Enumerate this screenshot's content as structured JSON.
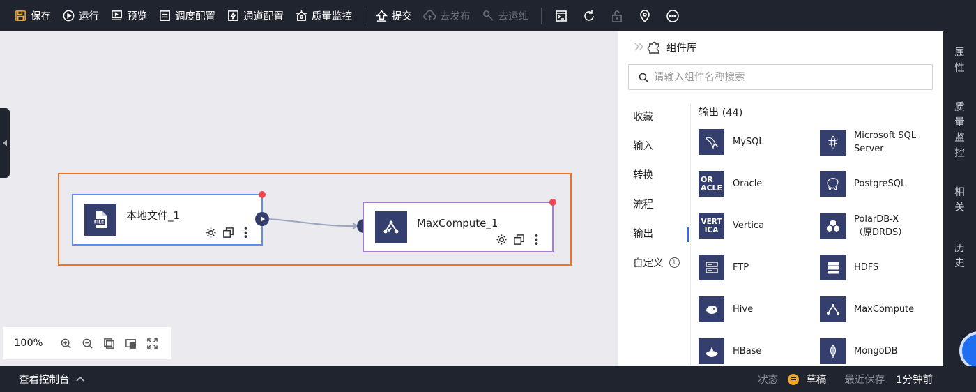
{
  "toolbar": {
    "save": "保存",
    "run": "运行",
    "preview": "预览",
    "schedule": "调度配置",
    "channel": "通道配置",
    "quality": "质量监控",
    "submit": "提交",
    "publish": "去发布",
    "ops": "去运维"
  },
  "canvas": {
    "nodes": {
      "source": {
        "label": "本地文件_1",
        "icon": "file-icon",
        "icon_text": "FILE"
      },
      "target": {
        "label": "MaxCompute_1",
        "icon": "maxcompute-icon"
      }
    },
    "zoom": "100%"
  },
  "panel": {
    "title": "组件库",
    "search_placeholder": "请输入组件名称搜索",
    "categories": [
      "收藏",
      "输入",
      "转换",
      "流程",
      "输出",
      "自定义"
    ],
    "active_category": "输出",
    "section_header": "输出 (44)",
    "components": [
      {
        "label": "MySQL",
        "icon": "mysql-icon"
      },
      {
        "label": "Microsoft SQL Server",
        "icon": "sqlserver-icon"
      },
      {
        "label": "Oracle",
        "icon": "oracle-icon",
        "icon_text": "OR\nACLE"
      },
      {
        "label": "PostgreSQL",
        "icon": "postgresql-icon"
      },
      {
        "label": "Vertica",
        "icon": "vertica-icon",
        "icon_text": "VERT\nICA"
      },
      {
        "label": "PolarDB-X（原DRDS）",
        "line1": "PolarDB-X",
        "line2": "（原DRDS）",
        "icon": "polardb-icon"
      },
      {
        "label": "FTP",
        "icon": "ftp-icon"
      },
      {
        "label": "HDFS",
        "icon": "hdfs-icon"
      },
      {
        "label": "Hive",
        "icon": "hive-icon"
      },
      {
        "label": "MaxCompute",
        "icon": "maxcompute-icon"
      },
      {
        "label": "HBase",
        "icon": "hbase-icon"
      },
      {
        "label": "MongoDB",
        "icon": "mongodb-icon"
      }
    ]
  },
  "right_rail": [
    "属性",
    "质量监控",
    "相关",
    "历史"
  ],
  "statusbar": {
    "console": "查看控制台",
    "status_label": "状态",
    "status_value": "草稿",
    "saved_label": "最近保存",
    "saved_value": "1分钟前"
  },
  "colors": {
    "toolbar_bg": "#20242e",
    "canvas_bg": "#ebeaee",
    "selection": "#f0731d",
    "source_border": "#5b8ef0",
    "target_border": "#a47fd1",
    "icon_bg": "#353f6e",
    "node_dot": "#ef4b54",
    "draft": "#f5a623",
    "active_tab": "#2f6fe8"
  }
}
